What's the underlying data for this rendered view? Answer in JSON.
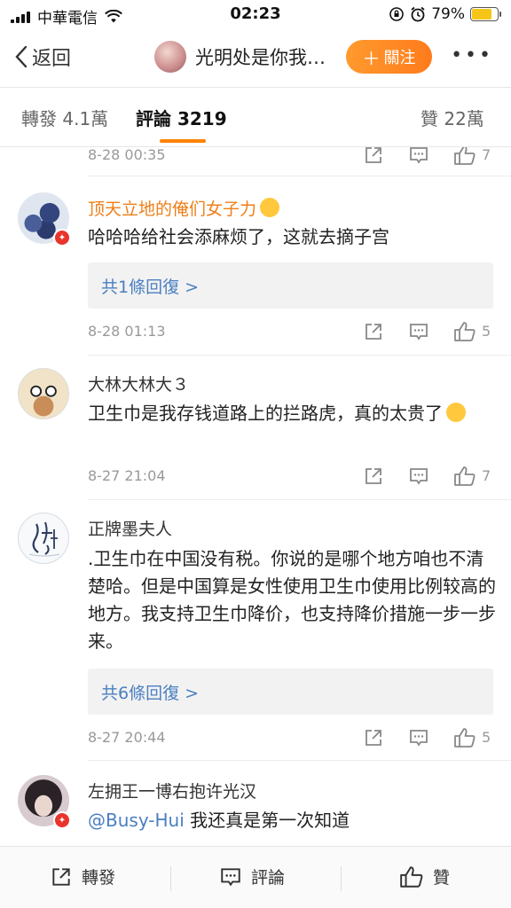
{
  "status_bar": {
    "carrier": "中華電信",
    "time": "02:23",
    "battery": "79%",
    "battery_level": 0.79
  },
  "nav": {
    "back_label": "返回",
    "title": "光明处是你我…",
    "follow_label": "關注",
    "more_label": "•••"
  },
  "tabs": {
    "repost": "轉發 4.1萬",
    "comments": "評論 3219",
    "likes": "贊 22萬"
  },
  "comments": [
    {
      "date": "8-28 00:35",
      "likes": "7"
    },
    {
      "username": "顶天立地的俺们女子力",
      "text": "哈哈哈给社会添麻烦了，这就去摘子宫",
      "reply": "共1條回復 >",
      "date": "8-28 01:13",
      "likes": "5"
    },
    {
      "username": "大林大林大３",
      "text": "卫生巾是我存钱道路上的拦路虎，真的太贵了",
      "date": "8-27 21:04",
      "likes": "7"
    },
    {
      "username": "正牌墨夫人",
      "text": ".卫生巾在中国没有税。你说的是哪个地方咱也不清楚哈。但是中国算是女性使用卫生巾使用比例较高的地方。我支持卫生巾降价，也支持降价措施一步一步来。",
      "reply": "共6條回復 >",
      "date": "8-27 20:44",
      "likes": "5"
    },
    {
      "username": "左拥王一博右抱许光汉",
      "mention": "@Busy-Hui",
      "text": "我还真是第一次知道"
    }
  ],
  "bottom_bar": {
    "repost": "轉發",
    "comment": "評論",
    "like": "贊"
  },
  "colors": {
    "accent": "#ff8200",
    "link": "#4a7fc1",
    "vip_name": "#ef7e17"
  }
}
